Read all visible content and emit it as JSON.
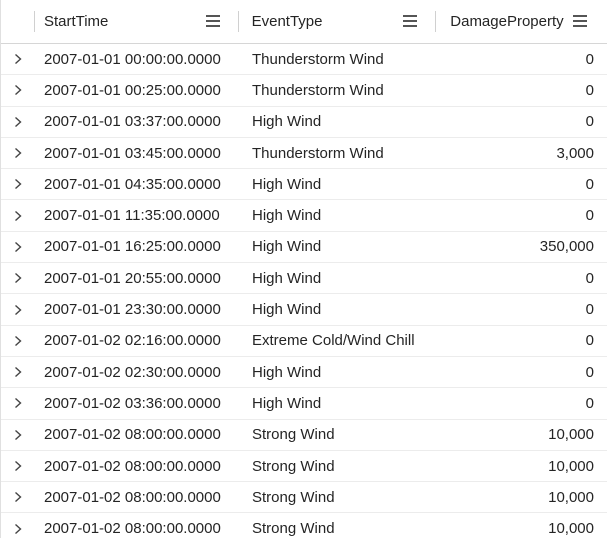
{
  "columns": {
    "start_time": "StartTime",
    "event_type": "EventType",
    "damage_property": "DamageProperty"
  },
  "icons": {
    "column_menu": "hamburger-menu-icon",
    "row_expand": "chevron-right-icon"
  },
  "rows": [
    {
      "start_time": "2007-01-01 00:00:00.0000",
      "event_type": "Thunderstorm Wind",
      "damage_property": "0"
    },
    {
      "start_time": "2007-01-01 00:25:00.0000",
      "event_type": "Thunderstorm Wind",
      "damage_property": "0"
    },
    {
      "start_time": "2007-01-01 03:37:00.0000",
      "event_type": "High Wind",
      "damage_property": "0"
    },
    {
      "start_time": "2007-01-01 03:45:00.0000",
      "event_type": "Thunderstorm Wind",
      "damage_property": "3,000"
    },
    {
      "start_time": "2007-01-01 04:35:00.0000",
      "event_type": "High Wind",
      "damage_property": "0"
    },
    {
      "start_time": "2007-01-01 11:35:00.0000",
      "event_type": "High Wind",
      "damage_property": "0"
    },
    {
      "start_time": "2007-01-01 16:25:00.0000",
      "event_type": "High Wind",
      "damage_property": "350,000"
    },
    {
      "start_time": "2007-01-01 20:55:00.0000",
      "event_type": "High Wind",
      "damage_property": "0"
    },
    {
      "start_time": "2007-01-01 23:30:00.0000",
      "event_type": "High Wind",
      "damage_property": "0"
    },
    {
      "start_time": "2007-01-02 02:16:00.0000",
      "event_type": "Extreme Cold/Wind Chill",
      "damage_property": "0"
    },
    {
      "start_time": "2007-01-02 02:30:00.0000",
      "event_type": "High Wind",
      "damage_property": "0"
    },
    {
      "start_time": "2007-01-02 03:36:00.0000",
      "event_type": "High Wind",
      "damage_property": "0"
    },
    {
      "start_time": "2007-01-02 08:00:00.0000",
      "event_type": "Strong Wind",
      "damage_property": "10,000"
    },
    {
      "start_time": "2007-01-02 08:00:00.0000",
      "event_type": "Strong Wind",
      "damage_property": "10,000"
    },
    {
      "start_time": "2007-01-02 08:00:00.0000",
      "event_type": "Strong Wind",
      "damage_property": "10,000"
    },
    {
      "start_time": "2007-01-02 08:00:00.0000",
      "event_type": "Strong Wind",
      "damage_property": "10,000"
    }
  ]
}
